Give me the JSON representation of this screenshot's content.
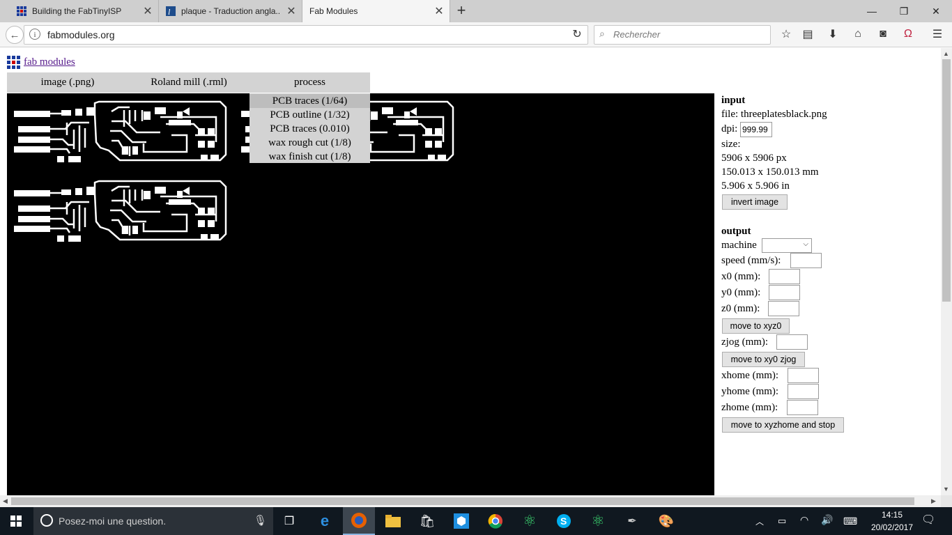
{
  "browser": {
    "tabs": [
      {
        "title": "Building the FabTinyISP"
      },
      {
        "title": "plaque - Traduction angla..."
      },
      {
        "title": "Fab Modules"
      }
    ],
    "url": "fabmodules.org",
    "search_placeholder": "Rechercher"
  },
  "page": {
    "logo_link": "fab modules",
    "menu": [
      "image (.png)",
      "Roland mill (.rml)",
      "process"
    ],
    "process_options": [
      "PCB traces (1/64)",
      "PCB outline (1/32)",
      "PCB traces (0.010)",
      "wax rough cut (1/8)",
      "wax finish cut (1/8)"
    ],
    "input": {
      "heading": "input",
      "file": "file: threeplatesblack.png",
      "dpi_label": "dpi:",
      "dpi_value": "999.99",
      "size_label": "size:",
      "size_px": "5906 x 5906 px",
      "size_mm": "150.013 x 150.013 mm",
      "size_in": "5.906 x 5.906 in",
      "invert_button": "invert image"
    },
    "output": {
      "heading": "output",
      "machine_label": "machine",
      "speed_label": "speed (mm/s):",
      "x0_label": "x0 (mm):",
      "y0_label": "y0 (mm):",
      "z0_label": "z0 (mm):",
      "move_xyz0": "move to xyz0",
      "zjog_label": "zjog (mm):",
      "move_xy0_zjog": "move to xy0 zjog",
      "xhome_label": "xhome (mm):",
      "yhome_label": "yhome (mm):",
      "zhome_label": "zhome (mm):",
      "move_home": "move to xyzhome and stop"
    }
  },
  "taskbar": {
    "search_placeholder": "Posez-moi une question.",
    "time": "14:15",
    "date": "20/02/2017"
  }
}
